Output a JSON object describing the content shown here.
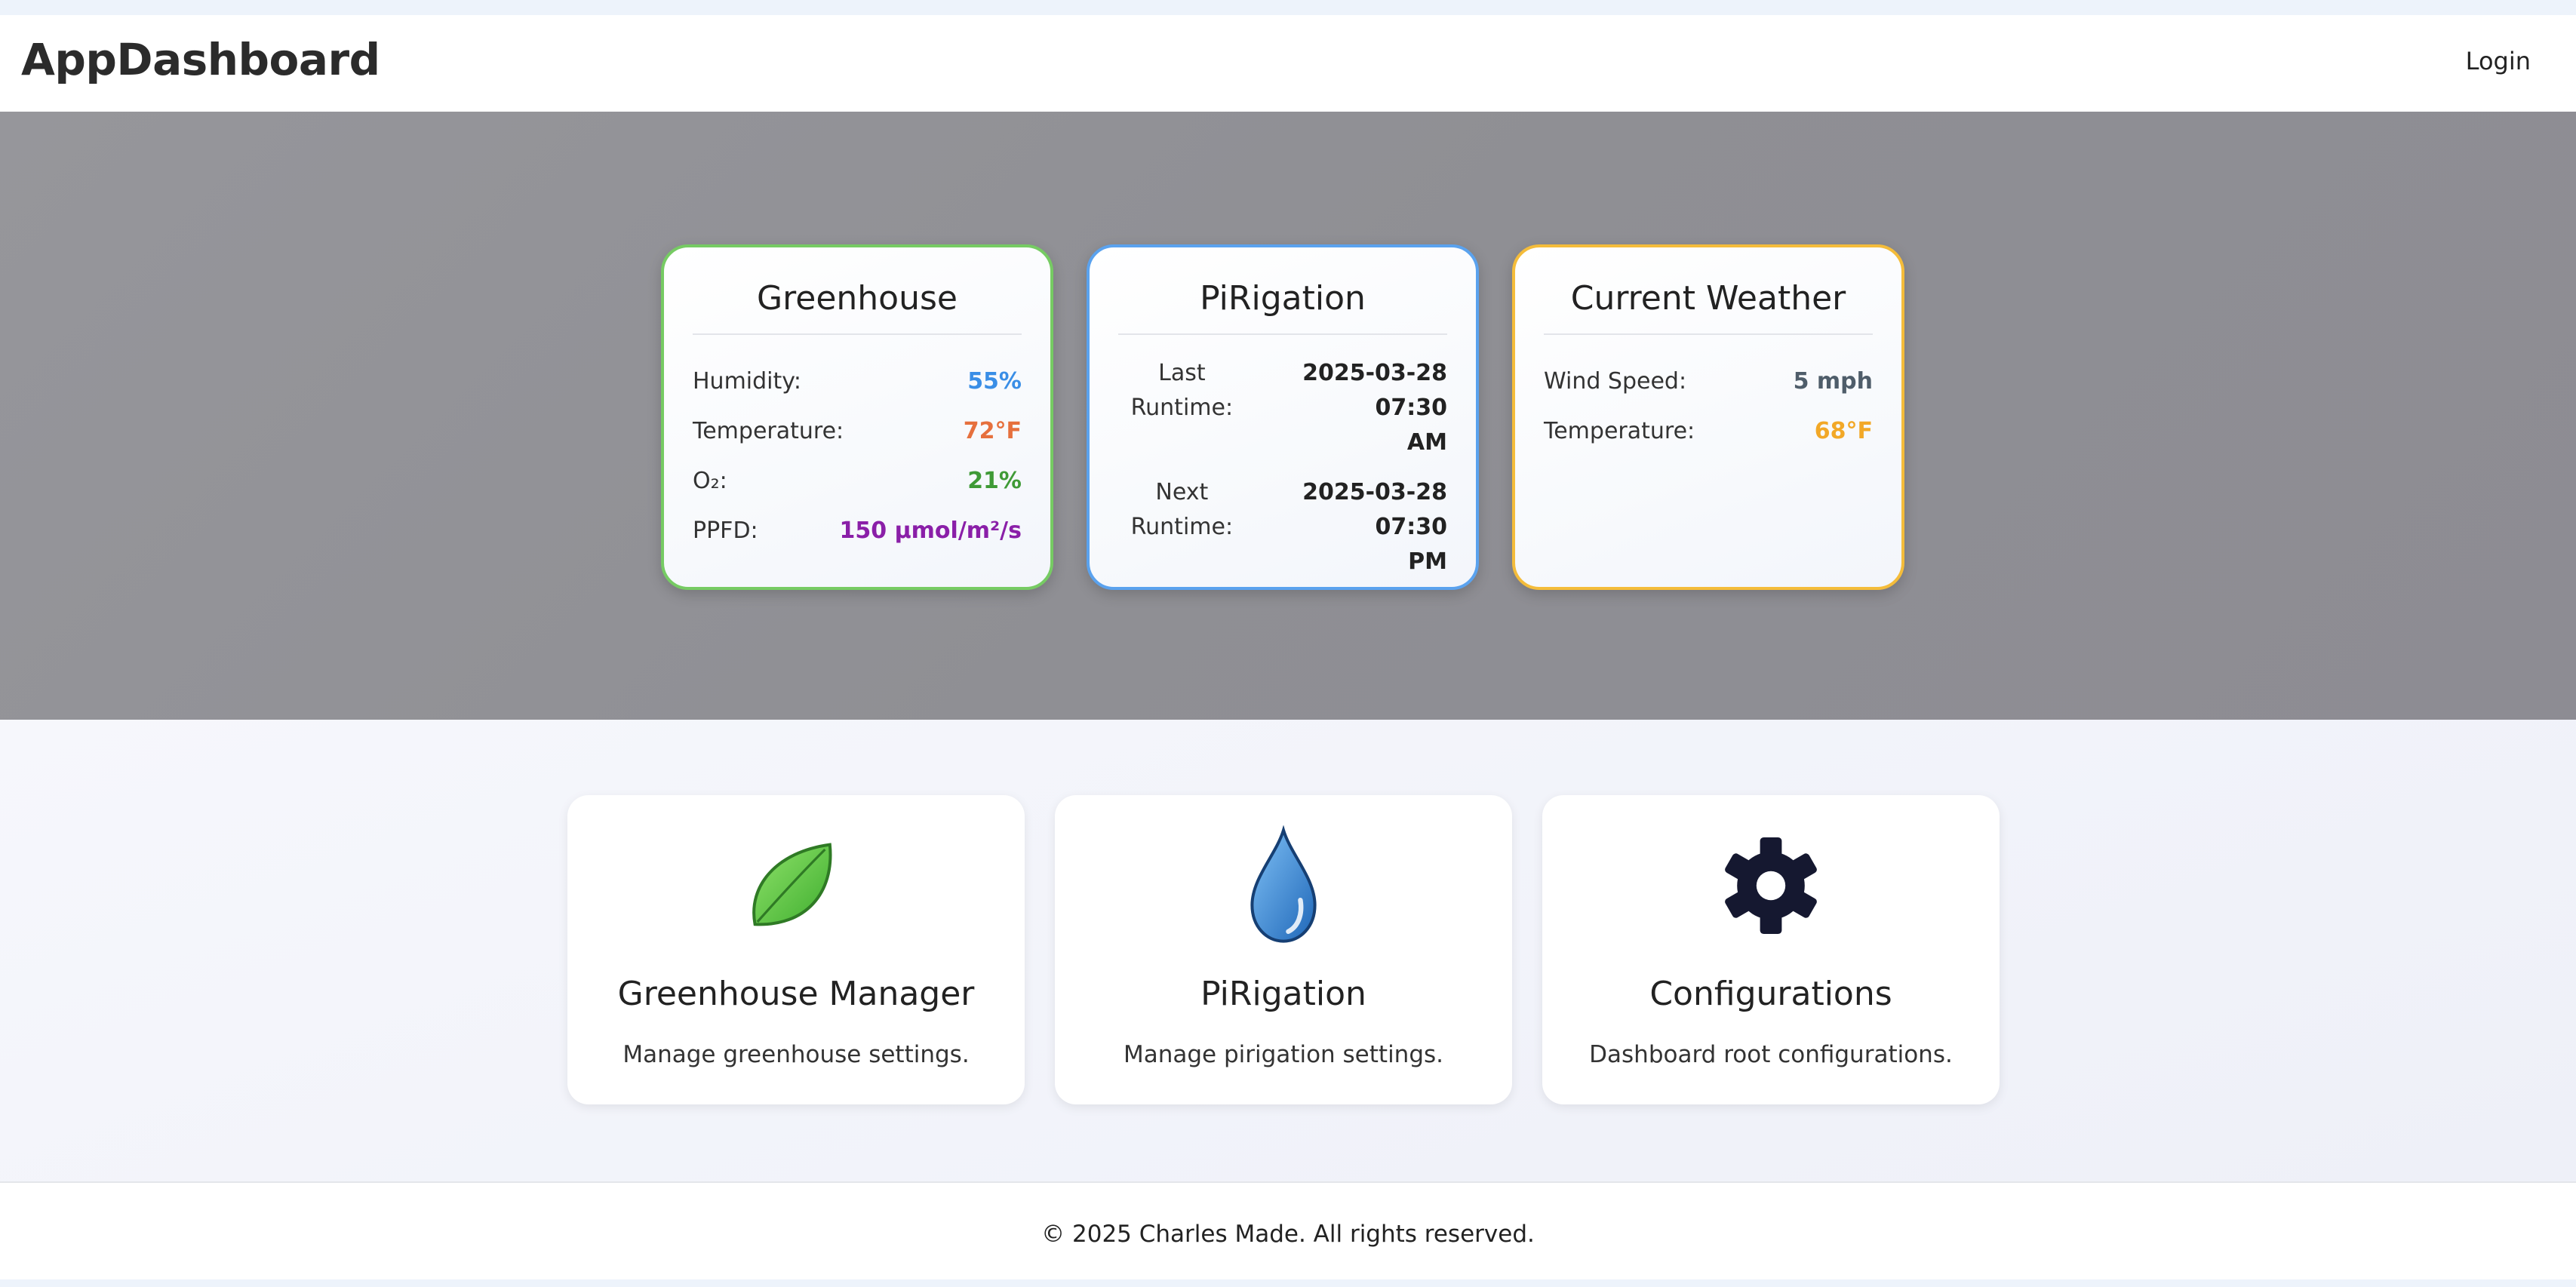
{
  "header": {
    "brand": "AppDashboard",
    "login_label": "Login"
  },
  "status_cards": {
    "greenhouse": {
      "title": "Greenhouse",
      "metrics": [
        {
          "label": "Humidity:",
          "value": "55%",
          "color": "#3a8ee6"
        },
        {
          "label": "Temperature:",
          "value": "72°F",
          "color": "#e6703d"
        },
        {
          "label": "O₂:",
          "value": "21%",
          "color": "#3f9a36"
        },
        {
          "label": "PPFD:",
          "value": "150 µmol/m²/s",
          "color": "#8a1fa8"
        }
      ],
      "border_color": "#76cb63"
    },
    "pirigation": {
      "title": "PiRigation",
      "last_runtime": {
        "label_line1": "Last",
        "label_line2": "Runtime:",
        "value_line1": "2025-03-28 07:30",
        "value_line2": "AM"
      },
      "next_runtime": {
        "label_line1": "Next",
        "label_line2": "Runtime:",
        "value_line1": "2025-03-28 07:30",
        "value_line2": "PM"
      },
      "border_color": "#5aa2ee"
    },
    "weather": {
      "title": "Current Weather",
      "metrics": [
        {
          "label": "Wind Speed:",
          "value": "5 mph",
          "color": "#4f5d6a"
        },
        {
          "label": "Temperature:",
          "value": "68°F",
          "color": "#f2a827"
        }
      ],
      "border_color": "#f4bc3a"
    }
  },
  "apps": [
    {
      "title": "Greenhouse Manager",
      "description": "Manage greenhouse settings.",
      "icon": "leaf-icon"
    },
    {
      "title": "PiRigation",
      "description": "Manage pirigation settings.",
      "icon": "water-drop-icon"
    },
    {
      "title": "Configurations",
      "description": "Dashboard root configurations.",
      "icon": "gear-icon"
    }
  ],
  "footer": {
    "text": "© 2025 Charles Made. All rights reserved."
  }
}
